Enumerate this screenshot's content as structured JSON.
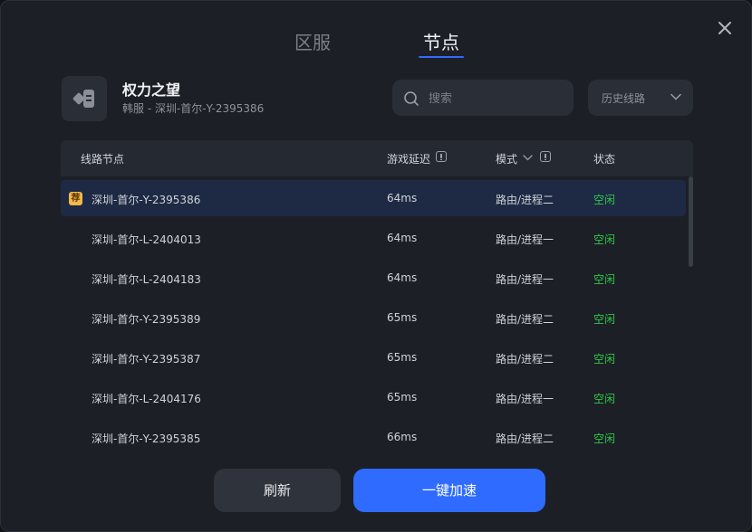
{
  "tabs": [
    {
      "label": "区服",
      "active": false
    },
    {
      "label": "节点",
      "active": true
    }
  ],
  "game": {
    "title": "权力之望",
    "subtitle": "韩服 - 深圳-首尔-Y-2395386"
  },
  "search": {
    "placeholder": "搜索",
    "value": ""
  },
  "history": {
    "label": "历史线路"
  },
  "table": {
    "headers": {
      "node": "线路节点",
      "latency": "游戏延迟",
      "mode": "模式",
      "status": "状态"
    },
    "rows": [
      {
        "badge": "荐",
        "node": "深圳-首尔-Y-2395386",
        "latency": "64ms",
        "mode": "路由/进程二",
        "status": "空闲",
        "selected": true
      },
      {
        "badge": "",
        "node": "深圳-首尔-L-2404013",
        "latency": "64ms",
        "mode": "路由/进程一",
        "status": "空闲",
        "selected": false
      },
      {
        "badge": "",
        "node": "深圳-首尔-L-2404183",
        "latency": "64ms",
        "mode": "路由/进程一",
        "status": "空闲",
        "selected": false
      },
      {
        "badge": "",
        "node": "深圳-首尔-Y-2395389",
        "latency": "65ms",
        "mode": "路由/进程二",
        "status": "空闲",
        "selected": false
      },
      {
        "badge": "",
        "node": "深圳-首尔-Y-2395387",
        "latency": "65ms",
        "mode": "路由/进程二",
        "status": "空闲",
        "selected": false
      },
      {
        "badge": "",
        "node": "深圳-首尔-L-2404176",
        "latency": "65ms",
        "mode": "路由/进程一",
        "status": "空闲",
        "selected": false
      },
      {
        "badge": "",
        "node": "深圳-首尔-Y-2395385",
        "latency": "66ms",
        "mode": "路由/进程二",
        "status": "空闲",
        "selected": false
      }
    ]
  },
  "buttons": {
    "refresh": "刷新",
    "accelerate": "一键加速"
  },
  "colors": {
    "accent": "#2f6bff",
    "status_idle": "#2fc84a",
    "badge": "#f2b84a"
  }
}
